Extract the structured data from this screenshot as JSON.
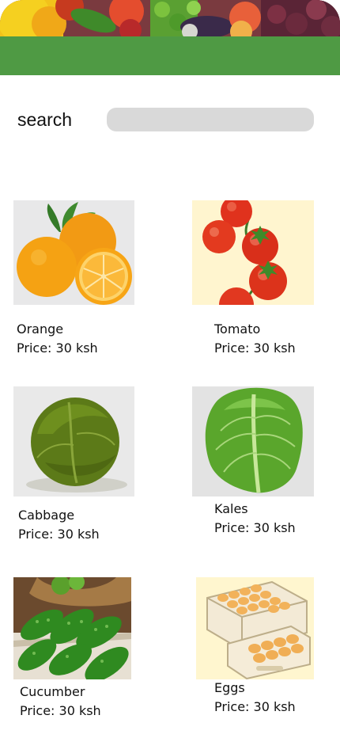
{
  "header": {
    "hero_alt": "assorted vegetables banner"
  },
  "search": {
    "label": "search",
    "value": "",
    "placeholder": ""
  },
  "products": [
    {
      "name": "Orange",
      "price": "Price: 30 ksh",
      "icon": "orange-image"
    },
    {
      "name": "Tomato",
      "price": "Price: 30 ksh",
      "icon": "tomato-image"
    },
    {
      "name": "Cabbage",
      "price": "Price: 30 ksh",
      "icon": "cabbage-image"
    },
    {
      "name": "Kales",
      "price": "Price: 30 ksh",
      "icon": "kales-image"
    },
    {
      "name": "Cucumber",
      "price": "Price: 30 ksh",
      "icon": "cucumber-image"
    },
    {
      "name": "Eggs",
      "price": "Price: 30 ksh",
      "icon": "eggs-image"
    }
  ],
  "colors": {
    "header_green": "#4f9a44",
    "search_field": "#d9d9d9",
    "text": "#111111"
  }
}
